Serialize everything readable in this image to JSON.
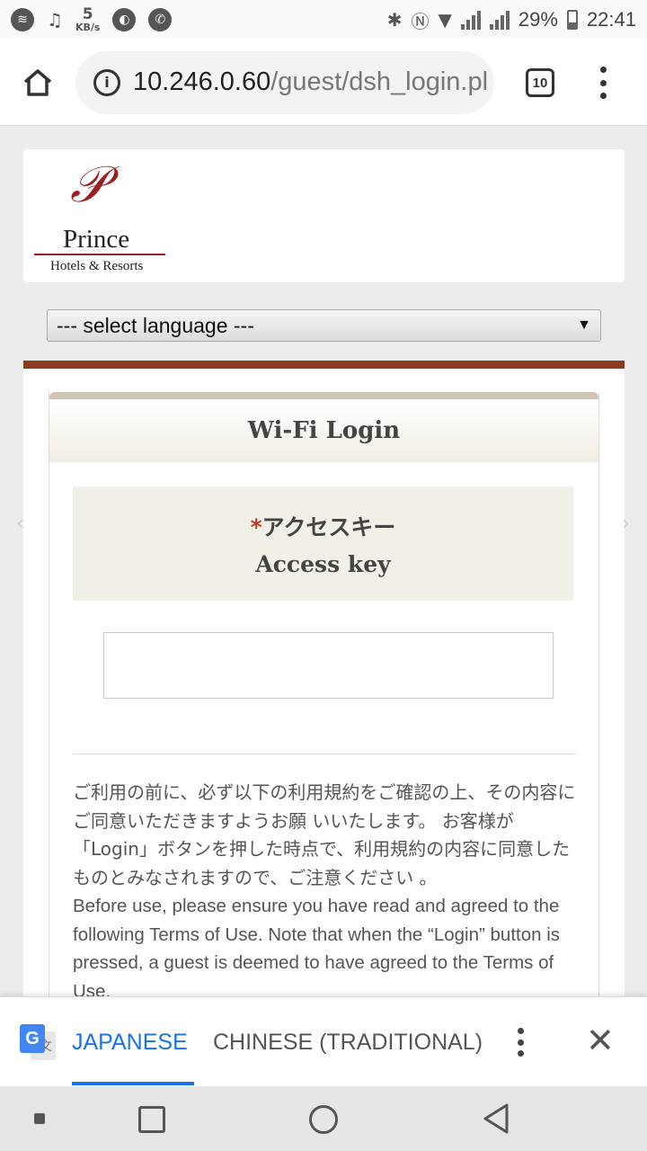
{
  "status_bar": {
    "net_speed_value": "5",
    "net_speed_unit": "KB/s",
    "battery": "29%",
    "time": "22:41"
  },
  "browser": {
    "url_host": "10.246.0.60",
    "url_path": "/guest/dsh_login.pl",
    "tab_count": "10"
  },
  "logo": {
    "brand": "Prince",
    "subtitle": "Hotels & Resorts"
  },
  "language_select": {
    "selected": "--- select language ---"
  },
  "login": {
    "title": "Wi-Fi Login",
    "required_mark": "*",
    "field_label_jp": "アクセスキー",
    "field_label_en": "Access key",
    "input_value": ""
  },
  "terms": {
    "jp": "ご利用の前に、必ず以下の利用規約をご確認の上、その内容にご同意いただきますようお願 いいたします。 お客様が「Login」ボタンを押した時点で、利用規約の内容に同意したものとみなされますので、ご注意ください 。",
    "en": "Before use, please ensure you have read and agreed to the following Terms of Use. Note that when the “Login” button is pressed, a guest is deemed to have agreed to the Terms of Use."
  },
  "translate_bar": {
    "tab_active": "JAPANESE",
    "tab_other": "CHINESE (TRADITIONAL)"
  },
  "colors": {
    "accent_brown": "#8b3b1f",
    "brand_red": "#9a1f1f",
    "translate_blue": "#1a73e8"
  }
}
